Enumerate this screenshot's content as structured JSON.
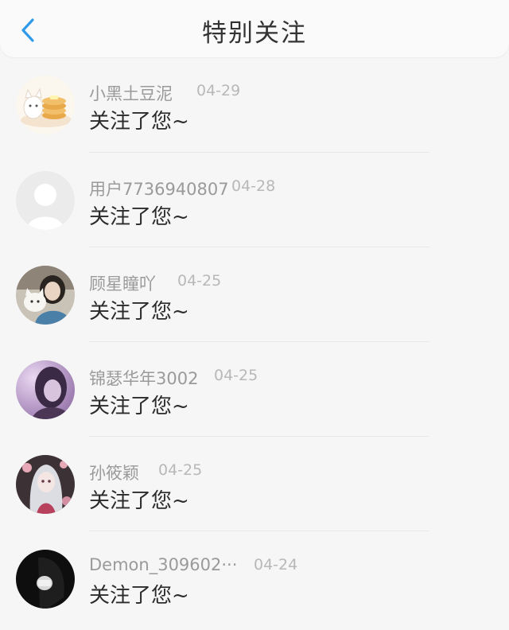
{
  "header": {
    "title": "特别关注",
    "back_icon": "chevron-left-icon",
    "accent_color": "#2f9be8"
  },
  "notifications": [
    {
      "name": "小黑土豆泥",
      "time": "04-29",
      "message": "关注了您~",
      "avatar": "cat-pancake-avatar"
    },
    {
      "name": "用户7736940807",
      "time": "04-28",
      "message": "关注了您~",
      "avatar": "default-user-avatar"
    },
    {
      "name": "顾星瞳吖",
      "time": "04-25",
      "message": "关注了您~",
      "avatar": "girl-with-cat-avatar"
    },
    {
      "name": "锦瑟华年3002",
      "time": "04-25",
      "message": "关注了您~",
      "avatar": "purple-portrait-avatar"
    },
    {
      "name": "孙筱颖",
      "time": "04-25",
      "message": "关注了您~",
      "avatar": "anime-character-avatar"
    },
    {
      "name": "Demon_309602···",
      "time": "04-24",
      "message": "关注了您~",
      "avatar": "dark-masked-avatar"
    }
  ]
}
